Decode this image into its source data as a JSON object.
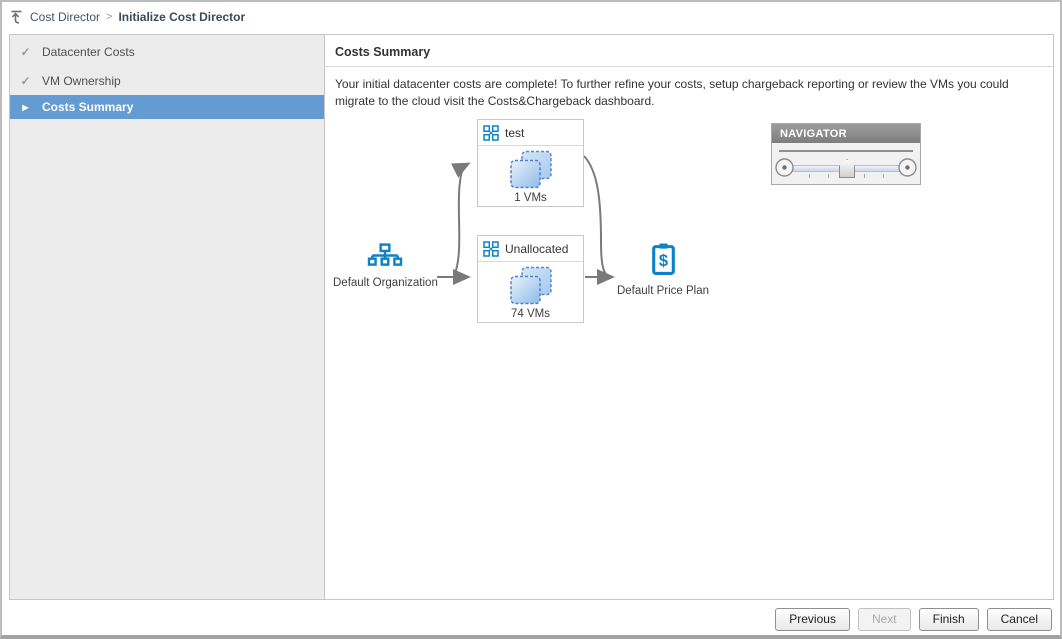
{
  "breadcrumb": {
    "parent": "Cost Director",
    "separator": ">",
    "current": "Initialize Cost Director"
  },
  "sidebar": {
    "steps": [
      {
        "label": "Datacenter Costs",
        "state": "complete"
      },
      {
        "label": "VM Ownership",
        "state": "complete"
      },
      {
        "label": "Costs Summary",
        "state": "active"
      }
    ]
  },
  "main": {
    "title": "Costs Summary",
    "intro": "Your initial datacenter costs are complete! To further refine your costs, setup chargeback reporting or review the VMs you could migrate to the cloud visit the Costs&Chargeback dashboard."
  },
  "diagram": {
    "organization": {
      "label": "Default Organization"
    },
    "groups": [
      {
        "name": "test",
        "vm_count": "1 VMs"
      },
      {
        "name": "Unallocated",
        "vm_count": "74 VMs"
      }
    ],
    "price_plan": {
      "label": "Default Price Plan"
    }
  },
  "navigator": {
    "title": "NAVIGATOR"
  },
  "footer": {
    "previous": "Previous",
    "next": "Next",
    "finish": "Finish",
    "cancel": "Cancel"
  },
  "icons": {
    "check": "✓",
    "active_arrow": "▶",
    "dollar": "$"
  },
  "colors": {
    "selection_blue": "#639bd2",
    "icon_blue": "#0e82c6",
    "arrow_gray": "#7a7a7a"
  }
}
